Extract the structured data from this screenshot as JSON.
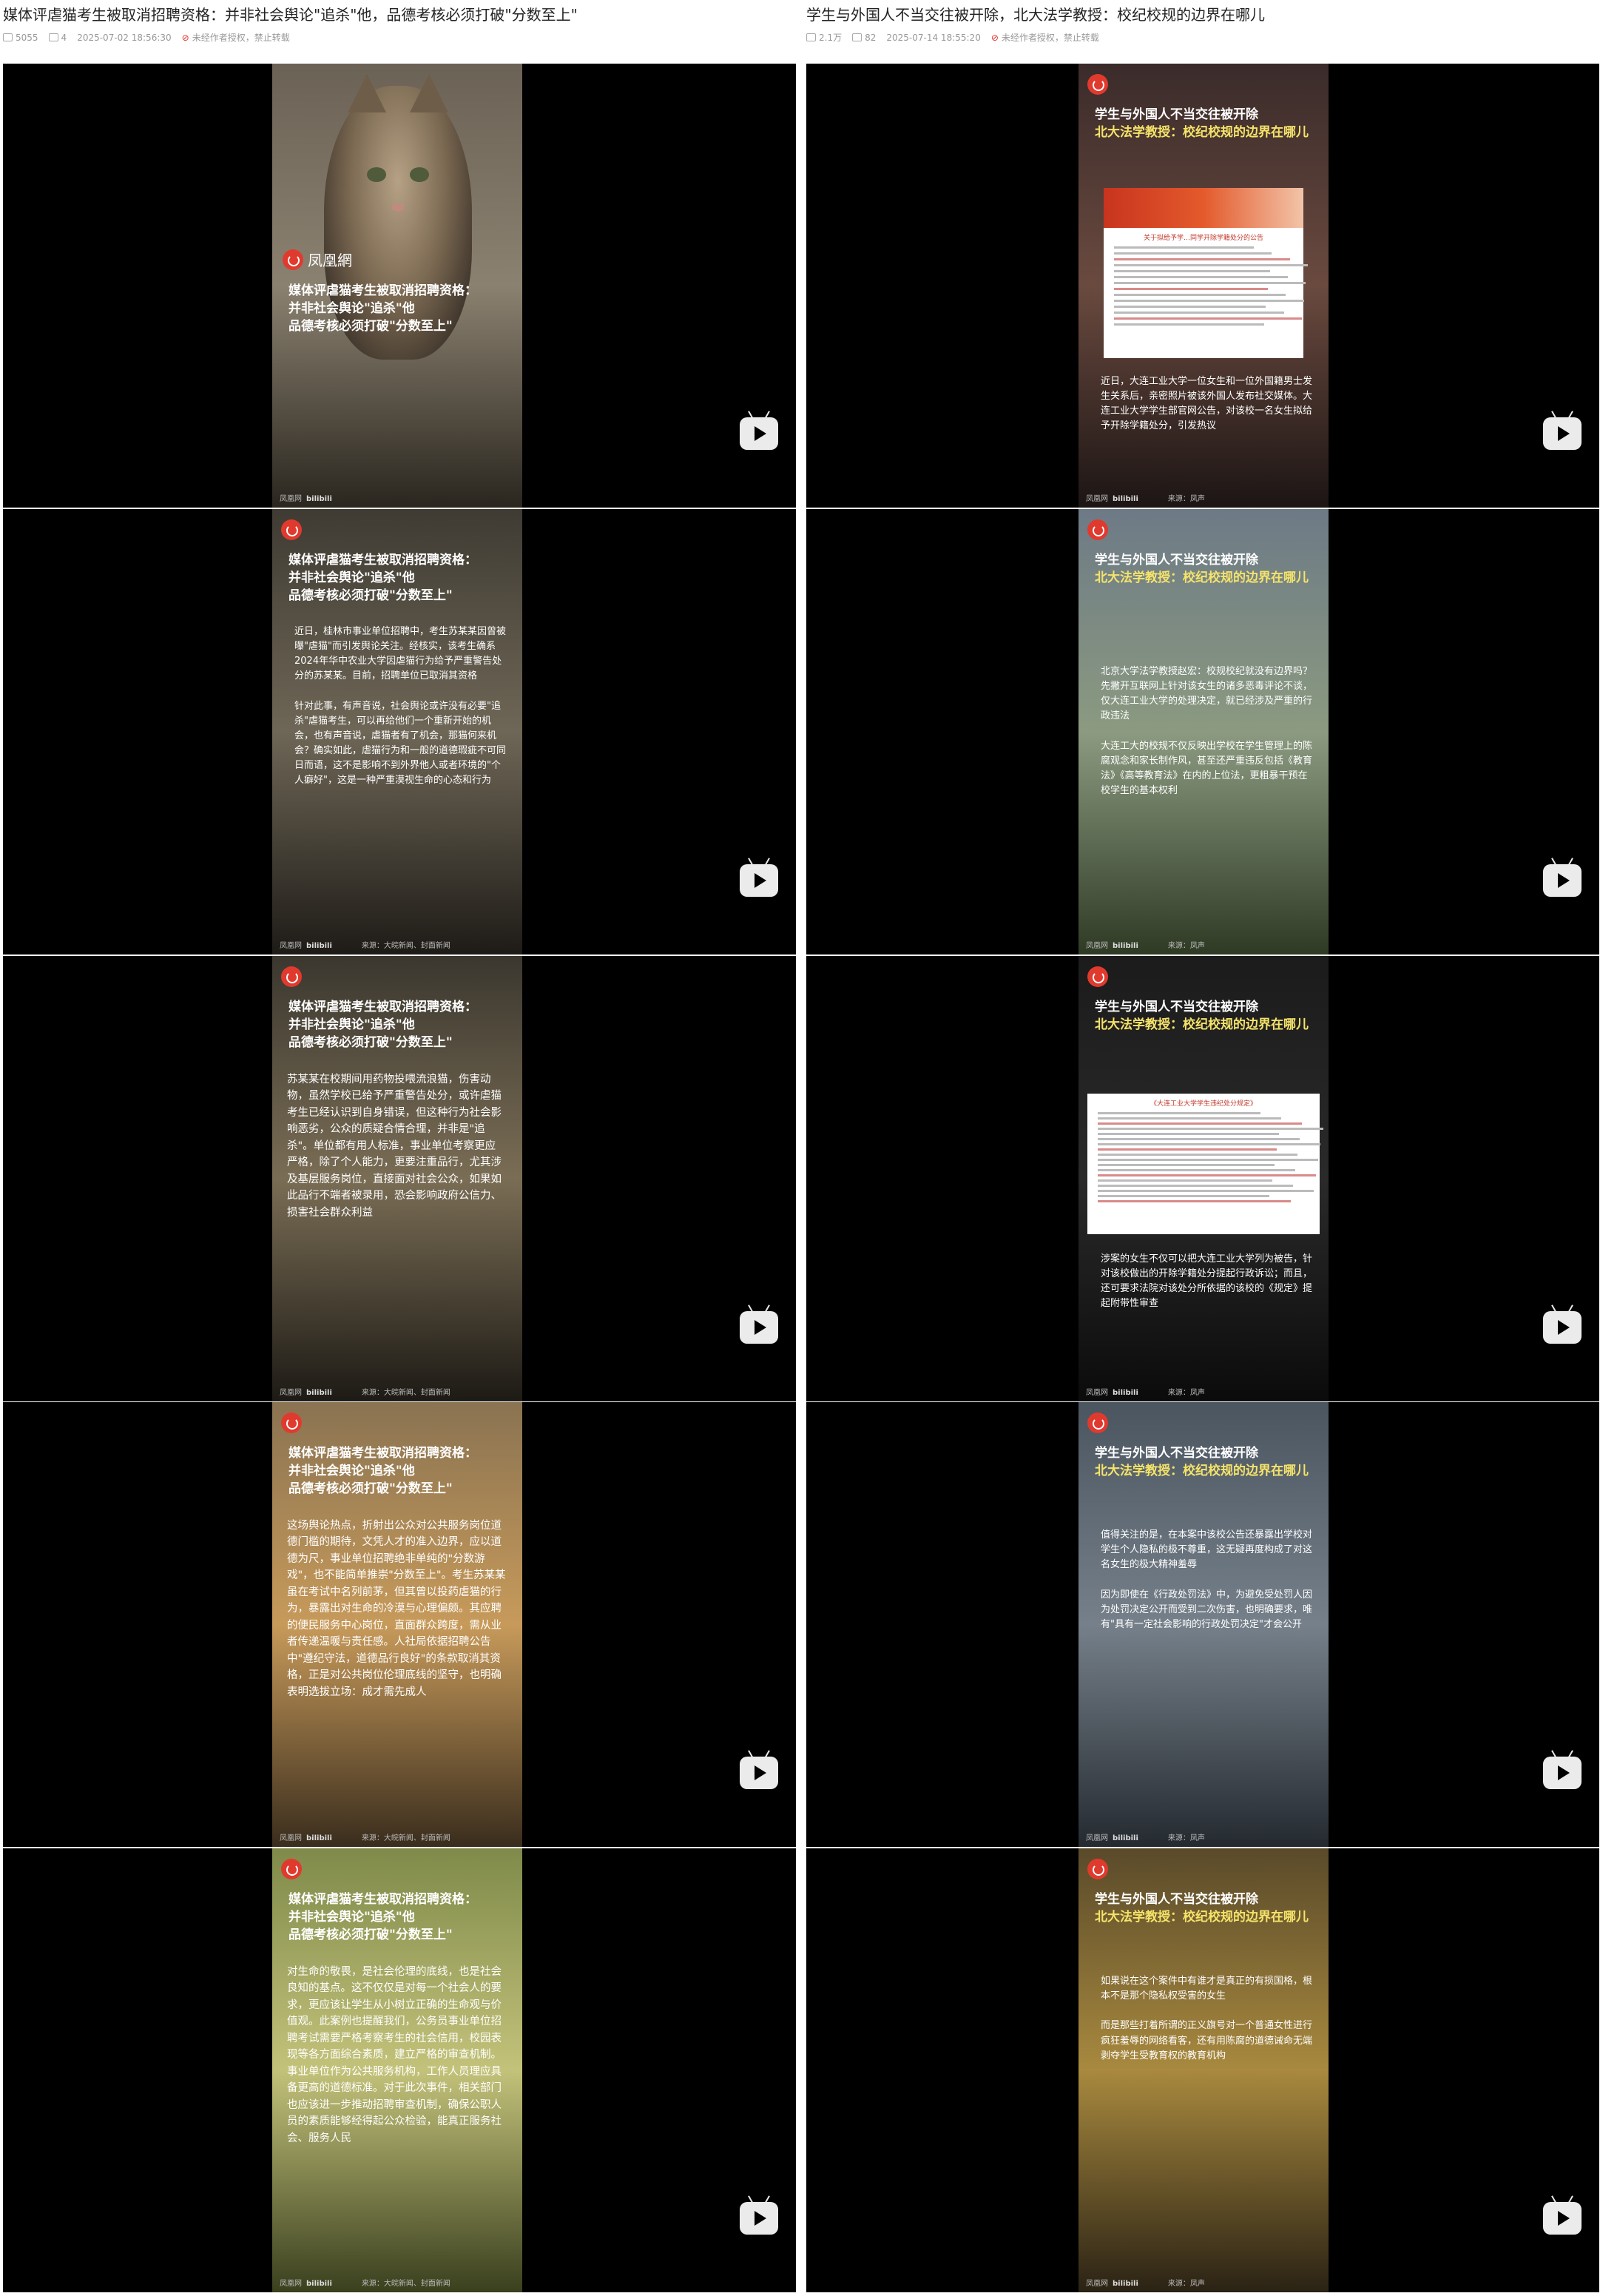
{
  "left": {
    "title": "媒体评虐猫考生被取消招聘资格：并非社会舆论\"追杀\"他，品德考核必须打破\"分数至上\"",
    "views": "5055",
    "comments": "4",
    "date": "2025-07-02 18:56:30",
    "copyright": "未经作者授权，禁止转载",
    "frames": [
      {
        "headline": [
          "媒体评虐猫考生被取消招聘资格：",
          "并非社会舆论\"追杀\"他",
          "品德考核必须打破\"分数至上\""
        ],
        "body": "",
        "logo": "凤凰網",
        "footer_left": "凤凰网",
        "footer_bili": "bilibili",
        "footer_src": "",
        "bg": [
          "#6b6256",
          "#8b8170",
          "#2a261f"
        ]
      },
      {
        "headline": [
          "媒体评虐猫考生被取消招聘资格：",
          "并非社会舆论\"追杀\"他",
          "品德考核必须打破\"分数至上\""
        ],
        "body": "近日，桂林市事业单位招聘中，考生苏某某因曾被曝\"虐猫\"而引发舆论关注。经核实，该考生确系2024年华中农业大学因虐猫行为给予严重警告处分的苏某某。目前，招聘单位已取消其资格\n\n针对此事，有声音说，社会舆论或许没有必要\"追杀\"虐猫考生，可以再给他们一个重新开始的机会，也有声音说，虐猫者有了机会，那猫何来机会？确实如此，虐猫行为和一般的道德瑕疵不可同日而语，这不是影响不到外界他人或者环境的\"个人癖好\"，这是一种严重漠视生命的心态和行为",
        "footer_left": "凤凰网",
        "footer_bili": "bilibili",
        "footer_src": "来源：大皖新闻、封面新闻",
        "bg": [
          "#3f3b33",
          "#6e6656",
          "#1e1b17"
        ]
      },
      {
        "headline": [
          "媒体评虐猫考生被取消招聘资格：",
          "并非社会舆论\"追杀\"他",
          "品德考核必须打破\"分数至上\""
        ],
        "body": "苏某某在校期间用药物投喂流浪猫，伤害动物，虽然学校已给予严重警告处分，或许虐猫考生已经认识到自身错误，但这种行为社会影响恶劣，公众的质疑合情合理，并非是\"追杀\"。单位都有用人标准，事业单位考察更应严格，除了个人能力，更要注重品行，尤其涉及基层服务岗位，直接面对社会公众，如果如此品行不端者被录用，恐会影响政府公信力、损害社会群众利益",
        "footer_left": "凤凰网",
        "footer_bili": "bilibili",
        "footer_src": "来源：大皖新闻、封面新闻",
        "bg": [
          "#3b372f",
          "#7a6d55",
          "#1d1a15"
        ]
      },
      {
        "headline": [
          "媒体评虐猫考生被取消招聘资格：",
          "并非社会舆论\"追杀\"他",
          "品德考核必须打破\"分数至上\""
        ],
        "body": "这场舆论热点，折射出公众对公共服务岗位道德门槛的期待，文凭人才的准入边界，应以道德为尺，事业单位招聘绝非单纯的\"分数游戏\"，也不能简单推崇\"分数至上\"。考生苏某某虽在考试中名列前茅，但其曾以投药虐猫的行为，暴露出对生命的冷漠与心理偏颇。其应聘的便民服务中心岗位，直面群众跨度，需从业者传递温暖与责任感。人社局依据招聘公告中\"遵纪守法，道德品行良好\"的条款取消其资格，正是对公共岗位伦理底线的坚守，也明确表明选拔立场：成才需先成人",
        "footer_left": "凤凰网",
        "footer_bili": "bilibili",
        "footer_src": "来源：大皖新闻、封面新闻",
        "bg": [
          "#8a7352",
          "#c79a5a",
          "#3a2d1d"
        ]
      },
      {
        "headline": [
          "媒体评虐猫考生被取消招聘资格：",
          "并非社会舆论\"追杀\"他",
          "品德考核必须打破\"分数至上\""
        ],
        "body": "对生命的敬畏，是社会伦理的底线，也是社会良知的基点。这不仅仅是对每一个社会人的要求，更应该让学生从小树立正确的生命观与价值观。此案例也提醒我们，公务员事业单位招聘考试需要严格考察考生的社会信用，校园表现等各方面综合素质，建立严格的审查机制。事业单位作为公共服务机构，工作人员理应具备更高的道德标准。对于此次事件，相关部门也应该进一步推动招聘审查机制，确保公职人员的素质能够经得起公众检验，能真正服务社会、服务人民",
        "footer_left": "凤凰网",
        "footer_bili": "bilibili",
        "footer_src": "来源：大皖新闻、封面新闻",
        "bg": [
          "#7f8a4a",
          "#c3c27a",
          "#3a3f1e"
        ]
      }
    ]
  },
  "right": {
    "title": "学生与外国人不当交往被开除，北大法学教授：校纪校规的边界在哪儿",
    "views": "2.1万",
    "comments": "82",
    "date": "2025-07-14 18:55:20",
    "copyright": "未经作者授权，禁止转载",
    "frames": [
      {
        "headline": [
          "学生与外国人不当交往被开除",
          "北大法学教授：校纪校规的边界在哪儿"
        ],
        "body": "近日，大连工业大学一位女生和一位外国籍男士发生关系后，亲密照片被该外国人发布社交媒体。大连工业大学学生部官网公告，对该校一名女生拟给予开除学籍处分，引发热议",
        "doc_header": "关于拟给予学…同学开除学籍处分的公告",
        "footer_left": "凤凰网",
        "footer_bili": "bilibili",
        "footer_src": "来源：凤声",
        "bg": [
          "#3a2b2a",
          "#6a4a3f",
          "#1c1514"
        ]
      },
      {
        "headline": [
          "学生与外国人不当交往被开除",
          "北大法学教授：校纪校规的边界在哪儿"
        ],
        "body": "北京大学法学教授赵宏：校规校纪就没有边界吗？先撇开互联网上针对该女生的诸多恶毒评论不谈，仅大连工业大学的处理决定，就已经涉及严重的行政违法\n\n大连工大的校规不仅反映出学校在学生管理上的陈腐观念和家长制作风，甚至还严重违反包括《教育法》《高等教育法》在内的上位法，更粗暴干预在校学生的基本权利",
        "footer_left": "凤凰网",
        "footer_bili": "bilibili",
        "footer_src": "来源：凤声",
        "bg": [
          "#6d7a86",
          "#8b9a80",
          "#2f3a25"
        ]
      },
      {
        "headline": [
          "学生与外国人不当交往被开除",
          "北大法学教授：校纪校规的边界在哪儿"
        ],
        "body": "涉案的女生不仅可以把大连工业大学列为被告，针对该校做出的开除学籍处分提起行政诉讼；而且，还可要求法院对该处分所依据的该校的《规定》提起附带性审查",
        "doc_header": "《大连工业大学学生违纪处分规定》",
        "footer_left": "凤凰网",
        "footer_bili": "bilibili",
        "footer_src": "来源：凤声",
        "bg": [
          "#1b1b1b",
          "#2a2a2a",
          "#0b0b0b"
        ]
      },
      {
        "headline": [
          "学生与外国人不当交往被开除",
          "北大法学教授：校纪校规的边界在哪儿"
        ],
        "body": "值得关注的是，在本案中该校公告还暴露出学校对学生个人隐私的极不尊重，这无疑再度构成了对这名女生的极大精神羞辱\n\n因为即使在《行政处罚法》中，为避免受处罚人因为处罚决定公开而受到二次伤害，也明确要求，唯有\"具有一定社会影响的行政处罚决定\"才会公开",
        "footer_left": "凤凰网",
        "footer_bili": "bilibili",
        "footer_src": "来源：凤声",
        "bg": [
          "#4a5560",
          "#76808a",
          "#242a30"
        ]
      },
      {
        "headline": [
          "学生与外国人不当交往被开除",
          "北大法学教授：校纪校规的边界在哪儿"
        ],
        "body": "如果说在这个案件中有谁才是真正的有损国格，根本不是那个隐私权受害的女生\n\n而是那些打着所谓的正义旗号对一个普通女性进行疯狂羞辱的网络看客，还有用陈腐的道德诫命无端剥夺学生受教育权的教育机构",
        "footer_left": "凤凰网",
        "footer_bili": "bilibili",
        "footer_src": "来源：凤声",
        "bg": [
          "#5a4a2a",
          "#a8893e",
          "#2a2214"
        ]
      }
    ]
  }
}
